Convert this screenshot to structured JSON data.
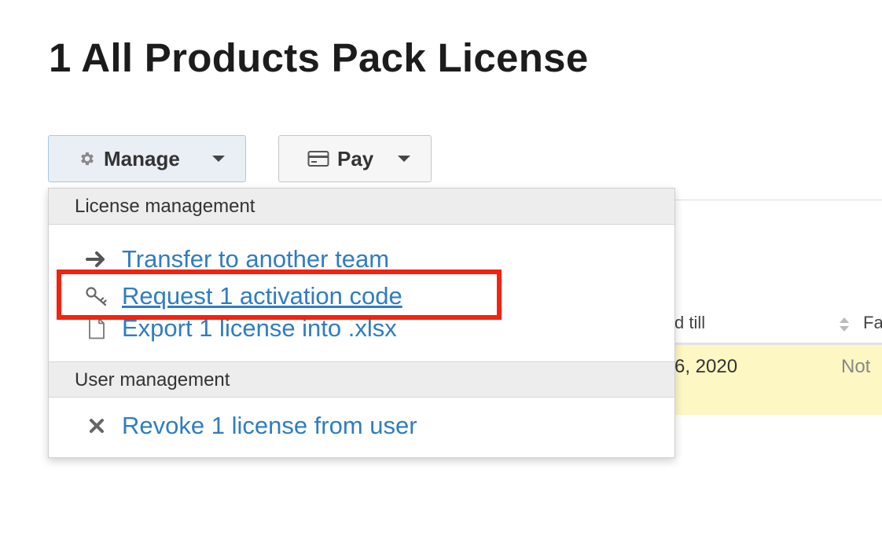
{
  "page": {
    "title": "1 All Products Pack License"
  },
  "toolbar": {
    "manage_label": "Manage",
    "pay_label": "Pay"
  },
  "dropdown": {
    "sections": [
      {
        "header": "License management"
      },
      {
        "header": "User management"
      }
    ],
    "items": [
      {
        "label": "Transfer to another team",
        "icon": "arrow-right-icon"
      },
      {
        "label": "Request 1 activation code",
        "icon": "key-icon"
      },
      {
        "label": "Export 1 license into .xlsx",
        "icon": "file-icon"
      },
      {
        "label": "Revoke 1 license from user",
        "icon": "close-icon"
      }
    ]
  },
  "background_table": {
    "headers": [
      "d till",
      "Fa"
    ],
    "row": [
      "6, 2020",
      "Not"
    ]
  },
  "colors": {
    "link": "#2f7dc1",
    "highlight": "#f3230f",
    "row_highlight": "#fdf7c3",
    "manage_button_bg": "#e9eff5"
  }
}
